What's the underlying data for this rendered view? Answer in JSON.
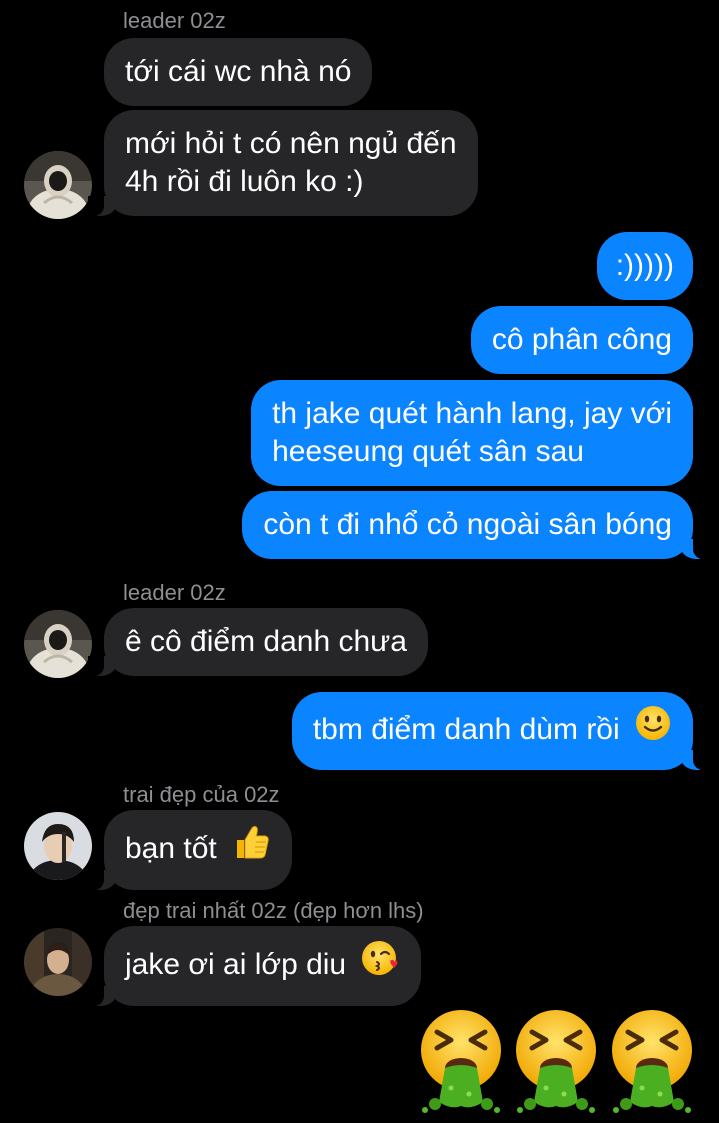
{
  "messages": {
    "m1_sender": "leader 02z",
    "m1_text": "tới cái wc nhà nó",
    "m2_line1": "mới hỏi t có nên ngủ đến",
    "m2_line2": "4h rồi đi luôn ko :)",
    "m3_text": ":)))))",
    "m4_text": "cô phân công",
    "m5_line1": "th jake quét hành lang, jay với",
    "m5_line2": "heeseung quét sân sau",
    "m6_text": "còn t đi nhổ cỏ ngoài sân bóng",
    "m7_sender": "leader 02z",
    "m7_text": "ê cô điểm danh chưa",
    "m8_text": "tbm điểm danh dùm rồi",
    "m9_sender": "trai đẹp của 02z",
    "m9_text": "bạn tốt",
    "m10_sender": "đẹp trai nhất 02z (đẹp hơn lhs)",
    "m10_text": "jake ơi ai lớp diu"
  },
  "icons": {
    "m8_emoji": "slightly-smiling-face-icon",
    "m9_emoji": "thumbs-up-icon",
    "m10_emoji": "face-blowing-kiss-icon",
    "bottom_emoji": "face-vomiting-icon"
  },
  "colors": {
    "incoming_bubble": "#262628",
    "outgoing_bubble": "#0a84ff",
    "background": "#000000",
    "sender_name": "#8e8e93"
  }
}
